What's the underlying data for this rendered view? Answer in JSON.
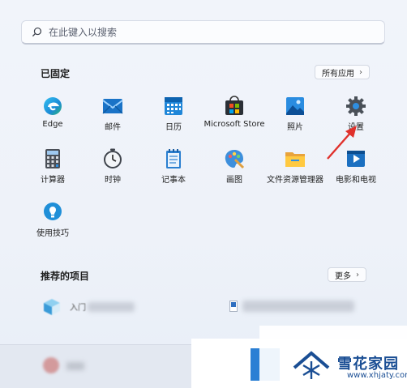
{
  "search": {
    "placeholder": "在此键入以搜索"
  },
  "pinned": {
    "title": "已固定",
    "all_apps_label": "所有应用",
    "apps": [
      {
        "label": "Edge",
        "icon": "edge-icon"
      },
      {
        "label": "邮件",
        "icon": "mail-icon"
      },
      {
        "label": "日历",
        "icon": "calendar-icon"
      },
      {
        "label": "Microsoft Store",
        "icon": "store-icon"
      },
      {
        "label": "照片",
        "icon": "photos-icon"
      },
      {
        "label": "设置",
        "icon": "settings-gear-icon"
      },
      {
        "label": "计算器",
        "icon": "calculator-icon"
      },
      {
        "label": "时钟",
        "icon": "clock-icon"
      },
      {
        "label": "记事本",
        "icon": "notepad-icon"
      },
      {
        "label": "画图",
        "icon": "paint-icon"
      },
      {
        "label": "文件资源管理器",
        "icon": "folder-icon"
      },
      {
        "label": "电影和电视",
        "icon": "movies-tv-icon"
      },
      {
        "label": "使用技巧",
        "icon": "tips-icon"
      }
    ]
  },
  "recommended": {
    "title": "推荐的项目",
    "more_label": "更多",
    "items": [
      {
        "label": "入门"
      }
    ]
  },
  "watermark": {
    "title": "雪花家园",
    "url": "www.xhjaty.com"
  },
  "colors": {
    "accent": "#0067c0",
    "arrow": "#e0312c",
    "watermark": "#1a4e94"
  }
}
